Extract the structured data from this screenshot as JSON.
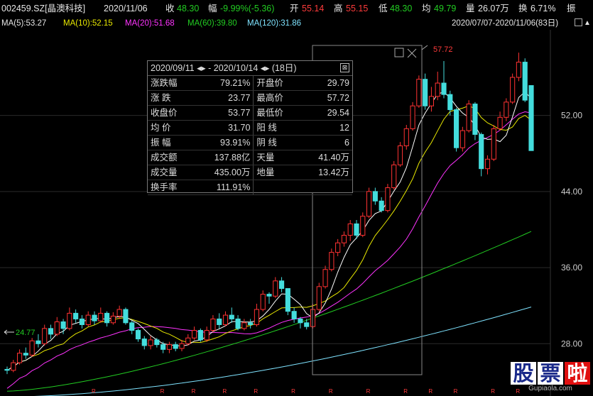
{
  "header": {
    "code": "002459.SZ[晶澳科技]",
    "date": "2020/11/06",
    "close_label": "收",
    "close": "48.30",
    "change_label": "幅",
    "change": "-9.99%(-5.36)",
    "open_label": "开",
    "open": "55.14",
    "high_label": "高",
    "high": "55.15",
    "low_label": "低",
    "low": "48.30",
    "avg_label": "均",
    "avg": "49.79",
    "vol_label": "量",
    "vol": "26.07万",
    "turnover_label": "换",
    "turnover": "6.71%",
    "amp_label": "振"
  },
  "ma": {
    "ma5": "MA(5):53.27",
    "ma10": "MA(10):52.15",
    "ma20": "MA(20):51.68",
    "ma60": "MA(60):39.80",
    "ma120": "MA(120):31.86",
    "range": "2020/07/07-2020/11/06(83日)"
  },
  "popup": {
    "title": "2020/09/11 ◂▸ - 2020/10/14 ◂▸   (18日)",
    "close_glyph": "⊠",
    "rows": [
      {
        "k1": "涨跌幅",
        "v1": "79.21%",
        "c1": "red",
        "k2": "开盘价",
        "v2": "29.79",
        "c2": "red"
      },
      {
        "k1": "涨  跌",
        "v1": "23.77",
        "c1": "red",
        "k2": "最高价",
        "v2": "57.72",
        "c2": "red"
      },
      {
        "k1": "收盘价",
        "v1": "53.77",
        "c1": "red",
        "k2": "最低价",
        "v2": "29.54",
        "c2": "red"
      },
      {
        "k1": "均  价",
        "v1": "31.70",
        "c1": "red",
        "k2": "阳  线",
        "v2": "12",
        "c2": "red"
      },
      {
        "k1": "振  幅",
        "v1": "93.91%",
        "c1": "red",
        "k2": "阴  线",
        "v2": "6",
        "c2": "green"
      },
      {
        "k1": "成交额",
        "v1": "137.88亿",
        "c1": "white",
        "k2": "天量",
        "v2": "41.40万",
        "c2": "white"
      },
      {
        "k1": "成交量",
        "v1": "435.00万",
        "c1": "white",
        "k2": "地量",
        "v2": "13.42万",
        "c2": "white"
      },
      {
        "k1": "换手率",
        "v1": "111.91%",
        "c1": "white",
        "k2": "",
        "v2": "",
        "c2": "white"
      }
    ]
  },
  "annotations": {
    "high_mark": "57.72",
    "low_mark": "24.77"
  },
  "watermark": {
    "chars": [
      "股",
      "票",
      "啦"
    ],
    "site": "Gupiaola.com"
  },
  "chart_data": {
    "type": "candlestick",
    "y_ticks": [
      "52.00",
      "44.00",
      "36.00",
      "28.00"
    ],
    "ylim": [
      22.5,
      61
    ],
    "colors": {
      "up": "#ff3232",
      "down": "#44dddd",
      "ma5": "#ffffff",
      "ma10": "#e8e800",
      "ma20": "#ff33ff",
      "ma60": "#22cc22",
      "ma120": "#7fe3ff"
    },
    "candles": [
      [
        25.3,
        25.2,
        25.6,
        24.8
      ],
      [
        25.2,
        26.0,
        26.3,
        25.0
      ],
      [
        26.0,
        27.0,
        27.4,
        25.8
      ],
      [
        27.0,
        26.8,
        27.6,
        26.4
      ],
      [
        26.8,
        28.3,
        28.6,
        26.6
      ],
      [
        28.3,
        28.0,
        29.0,
        27.6
      ],
      [
        28.0,
        29.6,
        30.0,
        27.8
      ],
      [
        29.6,
        29.0,
        30.0,
        28.5
      ],
      [
        29.0,
        30.3,
        30.8,
        28.8
      ],
      [
        30.3,
        29.6,
        30.6,
        29.0
      ],
      [
        29.6,
        31.2,
        31.8,
        29.4
      ],
      [
        31.2,
        30.6,
        31.6,
        30.2
      ],
      [
        30.6,
        30.0,
        31.0,
        29.6
      ],
      [
        30.0,
        31.0,
        31.4,
        29.8
      ],
      [
        31.0,
        30.4,
        31.4,
        30.0
      ],
      [
        30.4,
        31.2,
        31.8,
        30.2
      ],
      [
        31.2,
        30.2,
        31.4,
        29.8
      ],
      [
        30.2,
        30.9,
        31.3,
        30.0
      ],
      [
        30.9,
        31.6,
        32.0,
        30.6
      ],
      [
        31.6,
        30.2,
        31.8,
        30.0
      ],
      [
        30.2,
        29.4,
        30.4,
        29.0
      ],
      [
        29.4,
        28.5,
        29.6,
        28.2
      ],
      [
        28.5,
        27.8,
        28.8,
        27.4
      ],
      [
        27.8,
        28.4,
        28.8,
        27.4
      ],
      [
        28.4,
        27.9,
        28.6,
        27.6
      ],
      [
        27.9,
        27.4,
        28.2,
        27.0
      ],
      [
        27.4,
        27.9,
        28.2,
        27.0
      ],
      [
        27.9,
        27.5,
        28.2,
        27.2
      ],
      [
        27.5,
        28.0,
        28.4,
        27.2
      ],
      [
        28.0,
        28.6,
        29.0,
        27.8
      ],
      [
        28.6,
        29.4,
        29.8,
        28.4
      ],
      [
        29.4,
        28.4,
        29.6,
        28.2
      ],
      [
        28.4,
        29.4,
        29.8,
        28.2
      ],
      [
        29.4,
        30.6,
        31.0,
        29.2
      ],
      [
        30.6,
        30.0,
        31.2,
        29.6
      ],
      [
        30.0,
        31.0,
        31.4,
        29.8
      ],
      [
        31.0,
        30.6,
        31.8,
        30.2
      ],
      [
        30.6,
        29.6,
        31.0,
        29.4
      ],
      [
        29.6,
        30.2,
        30.6,
        29.4
      ],
      [
        30.2,
        30.0,
        30.6,
        29.6
      ],
      [
        30.0,
        31.6,
        32.2,
        29.8
      ],
      [
        31.6,
        33.2,
        33.6,
        31.4
      ],
      [
        33.2,
        33.0,
        33.4,
        32.2
      ],
      [
        33.0,
        34.6,
        35.0,
        32.8
      ],
      [
        34.6,
        33.8,
        35.0,
        33.4
      ],
      [
        33.8,
        31.4,
        33.8,
        31.0
      ],
      [
        31.4,
        30.6,
        31.8,
        30.2
      ],
      [
        30.6,
        30.2,
        30.8,
        29.6
      ],
      [
        30.2,
        29.8,
        30.6,
        29.5
      ],
      [
        29.8,
        31.6,
        32.2,
        29.6
      ],
      [
        31.6,
        34.0,
        34.4,
        31.4
      ],
      [
        34.0,
        35.8,
        36.2,
        33.8
      ],
      [
        35.8,
        37.6,
        38.0,
        35.6
      ],
      [
        37.6,
        38.6,
        39.0,
        37.2
      ],
      [
        38.6,
        39.4,
        39.8,
        38.2
      ],
      [
        39.4,
        40.6,
        41.0,
        38.8
      ],
      [
        40.6,
        39.4,
        41.0,
        39.0
      ],
      [
        39.4,
        41.4,
        41.8,
        39.2
      ],
      [
        41.4,
        44.0,
        44.4,
        41.2
      ],
      [
        44.0,
        43.0,
        44.4,
        42.6
      ],
      [
        43.0,
        42.0,
        43.4,
        41.8
      ],
      [
        42.0,
        44.4,
        44.8,
        41.8
      ],
      [
        44.4,
        46.8,
        47.2,
        44.2
      ],
      [
        46.8,
        48.8,
        49.2,
        46.6
      ],
      [
        48.8,
        50.6,
        51.0,
        48.4
      ],
      [
        50.6,
        53.0,
        53.4,
        50.4
      ],
      [
        53.0,
        55.8,
        56.2,
        52.8
      ],
      [
        55.8,
        53.0,
        56.4,
        52.6
      ],
      [
        53.0,
        54.0,
        55.0,
        52.4
      ],
      [
        54.0,
        55.4,
        56.6,
        53.6
      ],
      [
        55.4,
        54.2,
        57.72,
        53.8
      ],
      [
        54.2,
        52.6,
        54.6,
        52.0
      ],
      [
        52.6,
        48.6,
        52.8,
        48.2
      ],
      [
        48.6,
        50.4,
        50.8,
        48.2
      ],
      [
        50.4,
        53.2,
        53.6,
        50.2
      ],
      [
        53.2,
        50.0,
        53.4,
        49.4
      ],
      [
        50.0,
        46.4,
        50.2,
        45.6
      ],
      [
        46.4,
        47.4,
        47.8,
        45.8
      ],
      [
        47.4,
        50.6,
        51.0,
        47.2
      ],
      [
        50.6,
        51.8,
        52.4,
        50.4
      ],
      [
        51.8,
        53.4,
        53.8,
        51.4
      ],
      [
        53.4,
        56.0,
        56.4,
        53.2
      ],
      [
        56.0,
        57.6,
        58.6,
        55.6
      ],
      [
        57.6,
        53.6,
        58.0,
        53.4
      ],
      [
        55.14,
        48.3,
        55.15,
        48.3
      ]
    ]
  }
}
